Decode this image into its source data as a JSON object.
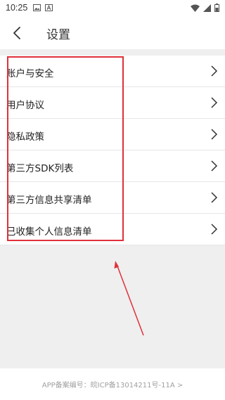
{
  "status_bar": {
    "time": "10:25",
    "icons": [
      "image-icon",
      "font-icon",
      "wifi-icon",
      "signal-icon",
      "battery-icon"
    ]
  },
  "header": {
    "title": "设置",
    "back_icon": "back-arrow-icon"
  },
  "settings": {
    "items": [
      {
        "label": "账户与安全"
      },
      {
        "label": "用户协议"
      },
      {
        "label": "隐私政策"
      },
      {
        "label": "第三方SDK列表"
      },
      {
        "label": "第三方信息共享清单"
      },
      {
        "label": "已收集个人信息清单"
      }
    ],
    "chevron_icon": "chevron-right-icon"
  },
  "footer": {
    "text": "APP备案编号：皖ICP备13014211号-11A >"
  },
  "colors": {
    "highlight": "#e0303a",
    "background": "#efefef"
  }
}
